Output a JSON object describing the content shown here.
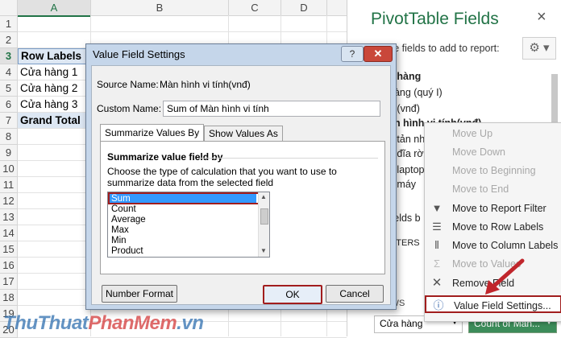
{
  "sheet": {
    "columns": [
      "A",
      "B",
      "C",
      "D"
    ],
    "rows": [
      "1",
      "2",
      "3",
      "4",
      "5",
      "6",
      "7",
      "8",
      "9",
      "10",
      "11",
      "12",
      "13",
      "14",
      "15",
      "16",
      "17",
      "18",
      "19",
      "20"
    ],
    "pivot": {
      "header": "Row Labels",
      "items": [
        "Cửa hàng 1",
        "Cửa hàng 2",
        "Cửa hàng 3"
      ],
      "total": "Grand Total"
    }
  },
  "pane": {
    "title": "PivotTable Fields",
    "close": "×",
    "subtitle": "se fields to add to report:",
    "gear": "⚙ ▾",
    "fields": [
      "a hàng",
      "hàng  (quý I)",
      "n (vnđ)",
      "àn hình vi tính(vnđ)",
      "ế tản nh",
      "a đĩa rời",
      "n laptop",
      "a máy"
    ],
    "fields_between": "fields b",
    "filters_label": "LTERS",
    "rows_label": "OWS",
    "rows_chip": "Cửa hàng",
    "values_chip": "Count of Màn..."
  },
  "context_menu": {
    "items": [
      {
        "label": "Move Up",
        "disabled": true,
        "icon": ""
      },
      {
        "label": "Move Down",
        "disabled": true,
        "icon": ""
      },
      {
        "label": "Move to Beginning",
        "disabled": true,
        "icon": ""
      },
      {
        "label": "Move to End",
        "disabled": true,
        "icon": ""
      },
      {
        "label": "Move to Report Filter",
        "disabled": false,
        "icon": "filter-icon"
      },
      {
        "label": "Move to Row Labels",
        "disabled": false,
        "icon": "rows-icon"
      },
      {
        "label": "Move to Column Labels",
        "disabled": false,
        "icon": "columns-icon"
      },
      {
        "label": "Move to Values",
        "disabled": true,
        "icon": "sigma-icon"
      },
      {
        "label": "Remove Field",
        "disabled": false,
        "icon": "remove-icon"
      },
      {
        "label": "Value Field Settings...",
        "disabled": false,
        "icon": "info-icon"
      }
    ]
  },
  "dialog": {
    "title": "Value Field Settings",
    "help": "?",
    "close": "✕",
    "source_label": "Source Name:",
    "source_value": "Màn hình vi tính(vnđ)",
    "custom_label": "Custom Name:",
    "custom_value": "Sum of Màn hình vi tính",
    "tabs": [
      "Summarize Values By",
      "Show Values As"
    ],
    "section_title": "Summarize value field by",
    "description": "Choose the type of calculation that you want to use to summarize data from the selected field",
    "functions": [
      "Sum",
      "Count",
      "Average",
      "Max",
      "Min",
      "Product"
    ],
    "selected_function": "Sum",
    "number_format": "Number Format",
    "ok": "OK",
    "cancel": "Cancel"
  },
  "watermark": {
    "part1": "ThuThuat",
    "part2": "PhanMem",
    "part3": ".vn"
  },
  "colors": {
    "excel_green": "#217346",
    "highlight_red": "#a11d1d",
    "selection_blue": "#3399ff"
  }
}
